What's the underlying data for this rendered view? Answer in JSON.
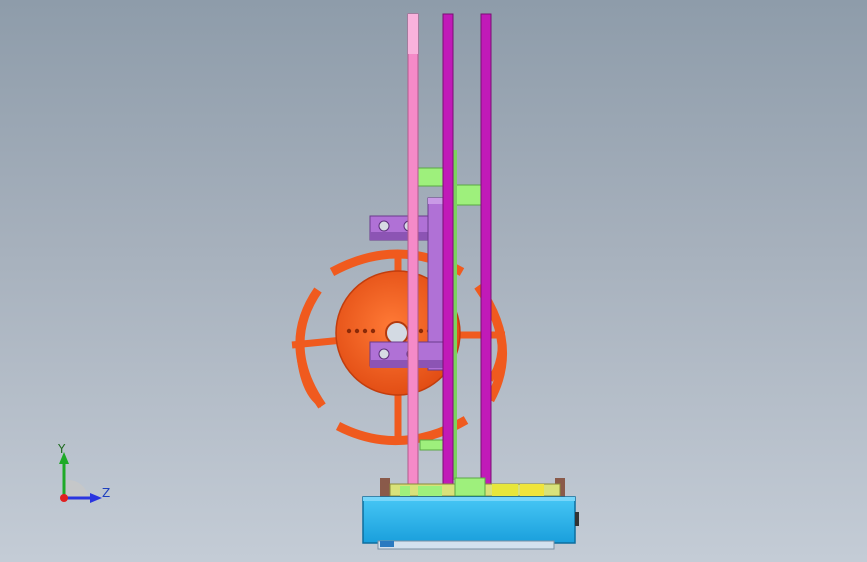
{
  "triad": {
    "y_label": "Y",
    "z_label": "Z",
    "colors": {
      "y": "#1faa28",
      "z": "#2a35e0",
      "x": "#e02020"
    }
  },
  "colors": {
    "background": "#a7b1bd",
    "wheel": "#f05a1e",
    "rod_pink": "#f58ac8",
    "rod_magenta": "#c11ab8",
    "bracket": "#b071d6",
    "block_green": "#9ef07c",
    "base": "#2fb6ee",
    "accent_yellow": "#e7e63a"
  }
}
